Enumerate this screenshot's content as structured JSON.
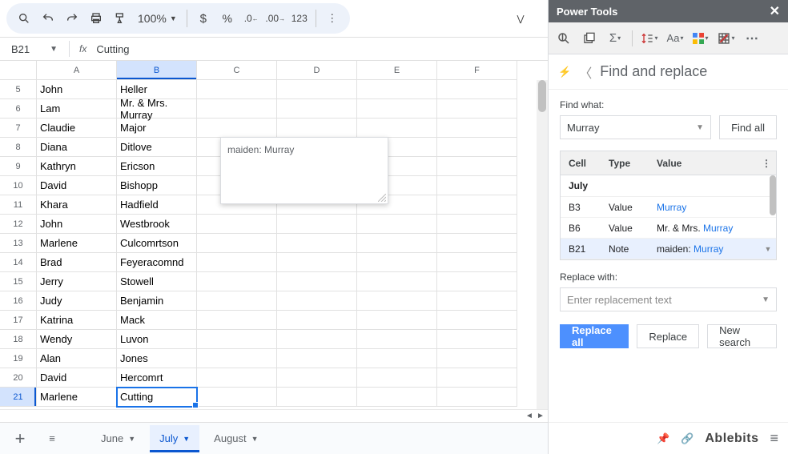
{
  "toolbar": {
    "zoom": "100%",
    "numfmt_123": "123"
  },
  "namebox": {
    "ref": "B21",
    "formula": "Cutting"
  },
  "columns": [
    "A",
    "B",
    "C",
    "D",
    "E",
    "F"
  ],
  "rows": [
    {
      "n": 5,
      "a": "John",
      "b": "Heller"
    },
    {
      "n": 6,
      "a": "Lam",
      "b": "Mr. & Mrs. Murray"
    },
    {
      "n": 7,
      "a": "Claudie",
      "b": "Major"
    },
    {
      "n": 8,
      "a": "Diana",
      "b": "Ditlove"
    },
    {
      "n": 9,
      "a": "Kathryn",
      "b": "Ericson"
    },
    {
      "n": 10,
      "a": "David",
      "b": "Bishopp"
    },
    {
      "n": 11,
      "a": "Khara",
      "b": "Hadfield"
    },
    {
      "n": 12,
      "a": "John",
      "b": "Westbrook"
    },
    {
      "n": 13,
      "a": "Marlene",
      "b": "Culcomrtson"
    },
    {
      "n": 14,
      "a": "Brad",
      "b": "Feyeracomnd"
    },
    {
      "n": 15,
      "a": "Jerry",
      "b": "Stowell"
    },
    {
      "n": 16,
      "a": "Judy",
      "b": "Benjamin"
    },
    {
      "n": 17,
      "a": "Katrina",
      "b": "Mack"
    },
    {
      "n": 18,
      "a": "Wendy",
      "b": "Luvon"
    },
    {
      "n": 19,
      "a": "Alan",
      "b": "Jones"
    },
    {
      "n": 20,
      "a": "David",
      "b": "Hercomrt"
    },
    {
      "n": 21,
      "a": "Marlene",
      "b": "Cutting"
    }
  ],
  "note": "maiden: Murray",
  "sheets": {
    "prev": "June",
    "active": "July",
    "next": "August"
  },
  "panel": {
    "title": "Power Tools",
    "crumb": "Find and replace",
    "find_label": "Find what:",
    "find_value": "Murray",
    "find_all": "Find all",
    "headers": {
      "cell": "Cell",
      "type": "Type",
      "value": "Value"
    },
    "group": "July",
    "results": [
      {
        "cell": "B3",
        "type": "Value",
        "pre": "",
        "match": "Murray",
        "post": ""
      },
      {
        "cell": "B6",
        "type": "Value",
        "pre": "Mr. & Mrs. ",
        "match": "Murray",
        "post": ""
      },
      {
        "cell": "B21",
        "type": "Note",
        "pre": "maiden: ",
        "match": "Murray",
        "post": ""
      }
    ],
    "replace_label": "Replace with:",
    "replace_placeholder": "Enter replacement text",
    "btn_replace_all": "Replace all",
    "btn_replace": "Replace",
    "btn_new_search": "New search",
    "brand": "Ablebits"
  }
}
